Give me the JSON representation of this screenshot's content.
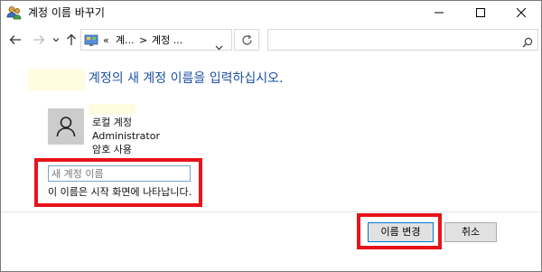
{
  "window": {
    "title": "계정 이름 바꾸기"
  },
  "address": {
    "overflow": "«",
    "segment1": "계...",
    "separator": ">",
    "segment2": "계정 ..."
  },
  "content": {
    "heading": "계정의 새 계정 이름을 입력하십시오.",
    "account": {
      "type": "로컬 계정",
      "name": "Administrator",
      "password_status": "암호 사용"
    },
    "name_input": {
      "placeholder": "새 계정 이름",
      "value": ""
    },
    "hint": "이 이름은 시작 화면에 나타납니다."
  },
  "buttons": {
    "rename": "이름 변경",
    "cancel": "취소"
  },
  "colors": {
    "heading": "#1b51a5",
    "annotation_box": "#e8131b",
    "highlight": "#fffbe0"
  },
  "icons": [
    "users-icon",
    "minimize-icon",
    "maximize-icon",
    "close-icon",
    "back-arrow-icon",
    "forward-arrow-icon",
    "recent-dropdown-icon",
    "up-arrow-icon",
    "control-panel-icon",
    "address-dropdown-icon",
    "refresh-icon",
    "search-icon",
    "user-avatar-icon"
  ]
}
